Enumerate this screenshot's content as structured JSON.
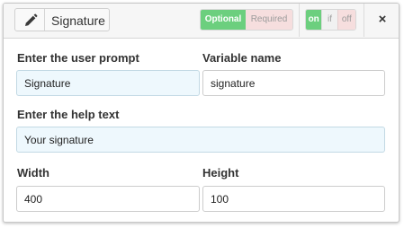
{
  "header": {
    "title": "Signature",
    "icon": "pencil-icon",
    "required_toggle": {
      "optional_label": "Optional",
      "required_label": "Required",
      "selected": "Optional"
    },
    "state_toggle": {
      "on_label": "on",
      "if_label": "if",
      "off_label": "off",
      "selected": "on"
    },
    "close_label": "×"
  },
  "form": {
    "prompt": {
      "label": "Enter the user prompt",
      "value": "Signature"
    },
    "variable": {
      "label": "Variable name",
      "value": "signature"
    },
    "help": {
      "label": "Enter the help text",
      "value": "Your signature"
    },
    "width": {
      "label": "Width",
      "value": "400"
    },
    "height": {
      "label": "Height",
      "value": "100"
    }
  },
  "colors": {
    "selected_green": "#6ccf7e",
    "unselected_red_tint": "#f6dede",
    "field_tint": "#eef8fd"
  }
}
